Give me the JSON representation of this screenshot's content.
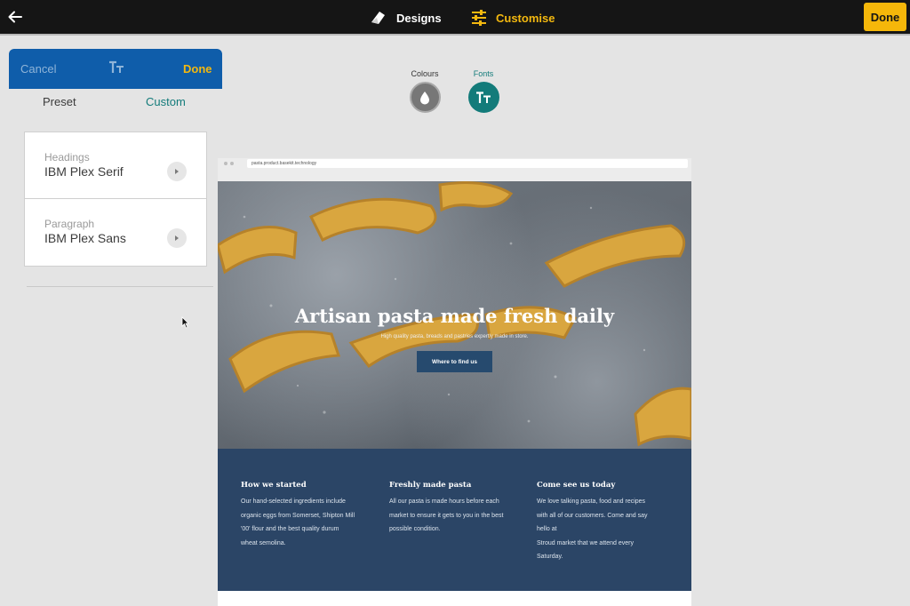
{
  "topbar": {
    "back_icon": "arrow-left-icon",
    "tabs": [
      {
        "label": "Designs",
        "icon": "designs-icon",
        "active": false
      },
      {
        "label": "Customise",
        "icon": "sliders-icon",
        "active": true
      }
    ],
    "done_label": "Done",
    "colors": {
      "background": "#151515",
      "accent": "#f3b80f"
    }
  },
  "panel": {
    "cancel_label": "Cancel",
    "header_icon": "text-size-icon",
    "done_label": "Done",
    "segments": [
      {
        "label": "Preset",
        "active": false
      },
      {
        "label": "Custom",
        "active": true
      }
    ],
    "fonts": [
      {
        "label": "Headings",
        "value": "IBM Plex Serif"
      },
      {
        "label": "Paragraph",
        "value": "IBM Plex Sans"
      }
    ],
    "colors": {
      "header": "#0f5daa",
      "teal": "#137b7a"
    }
  },
  "options": [
    {
      "label": "Colours",
      "icon": "droplet-icon",
      "active": false
    },
    {
      "label": "Fonts",
      "icon": "text-size-icon",
      "active": true
    }
  ],
  "preview": {
    "url": "pasta.product.basekit.technology",
    "hero": {
      "title": "Artisan pasta made fresh daily",
      "subtitle": "High quality pasta, breads and pastries expertly made in store.",
      "button_label": "Where to find us"
    },
    "columns": [
      {
        "heading": "How we started",
        "lines": [
          "Our hand-selected ingredients include",
          "organic eggs from Somerset, Shipton Mill",
          "'00' flour and the best quality durum",
          "wheat semolina."
        ]
      },
      {
        "heading": "Freshly made pasta",
        "lines": [
          "All our pasta is made hours before each",
          "market to ensure it gets to you in the best",
          "possible condition."
        ]
      },
      {
        "heading": "Come see us today",
        "lines": [
          "We love talking pasta, food and recipes",
          "with all of our customers. Come and say",
          "hello at",
          "Stroud market that we attend every",
          "Saturday."
        ]
      }
    ],
    "colors": {
      "footer": "#2b4566",
      "button": "#264a6e"
    }
  }
}
